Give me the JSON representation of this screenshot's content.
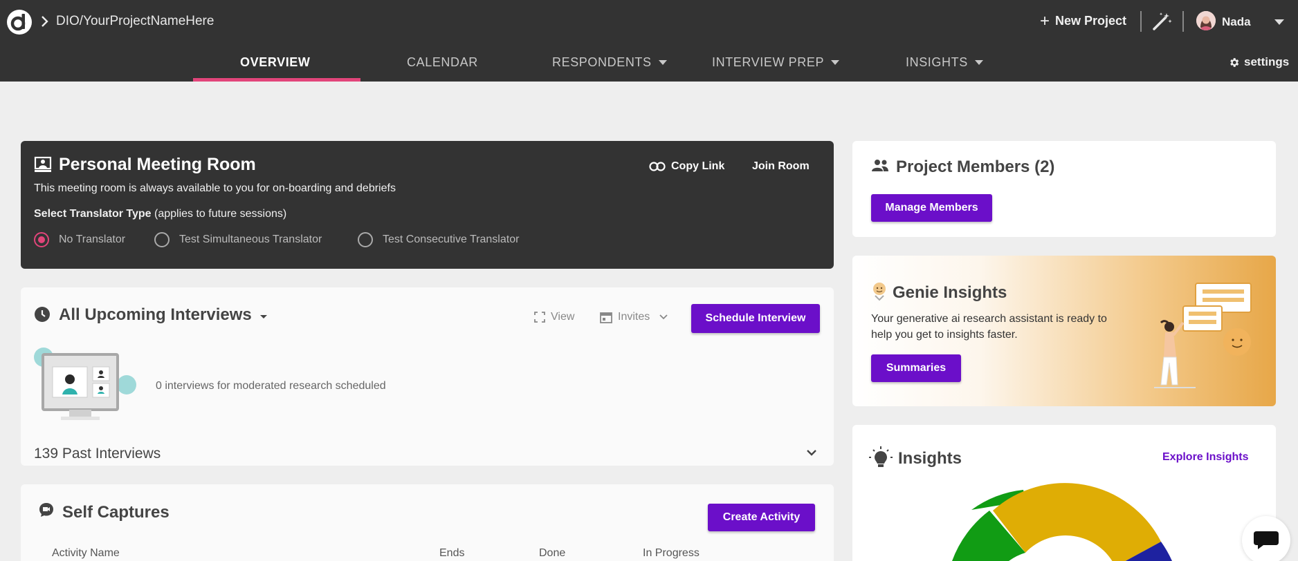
{
  "header": {
    "project_path": "DIO/YourProjectNameHere",
    "new_project_label": "New Project",
    "user_name": "Nada",
    "settings_label": "settings"
  },
  "nav": {
    "tabs": [
      {
        "label": "OVERVIEW",
        "active": true
      },
      {
        "label": "CALENDAR"
      },
      {
        "label": "RESPONDENTS",
        "dropdown": true
      },
      {
        "label": "INTERVIEW PREP",
        "dropdown": true
      },
      {
        "label": "INSIGHTS",
        "dropdown": true
      }
    ]
  },
  "meeting_room": {
    "title": "Personal Meeting Room",
    "description": "This meeting room is always available to you for on-boarding and debriefs",
    "select_label": "Select Translator Type",
    "select_note": "(applies to future sessions)",
    "copy_link_label": "Copy Link",
    "join_room_label": "Join Room",
    "options": [
      "No Translator",
      "Test Simultaneous Translator",
      "Test Consecutive Translator"
    ],
    "selected": "No Translator"
  },
  "upcoming": {
    "title": "All Upcoming Interviews",
    "view_label": "View",
    "invites_label": "Invites",
    "schedule_label": "Schedule Interview",
    "empty_text": "0 interviews for moderated research scheduled",
    "past_label": "139 Past Interviews"
  },
  "self_captures": {
    "title": "Self Captures",
    "create_label": "Create Activity",
    "columns": [
      "Activity Name",
      "Ends",
      "Done",
      "In Progress"
    ]
  },
  "members": {
    "title": "Project Members (2)",
    "manage_label": "Manage Members"
  },
  "genie": {
    "title": "Genie Insights",
    "description_line1": "Your generative ai research assistant is ready to",
    "description_line2": "help you get to insights faster.",
    "summaries_label": "Summaries"
  },
  "insights": {
    "title": "Insights",
    "explore_label": "Explore Insights"
  },
  "colors": {
    "accent_purple": "#6b0fc9",
    "accent_pink": "#e2457a",
    "topbar": "#333333",
    "chart_green": "#119c14",
    "chart_gold": "#dfad05",
    "chart_blue": "#1e22a0"
  }
}
